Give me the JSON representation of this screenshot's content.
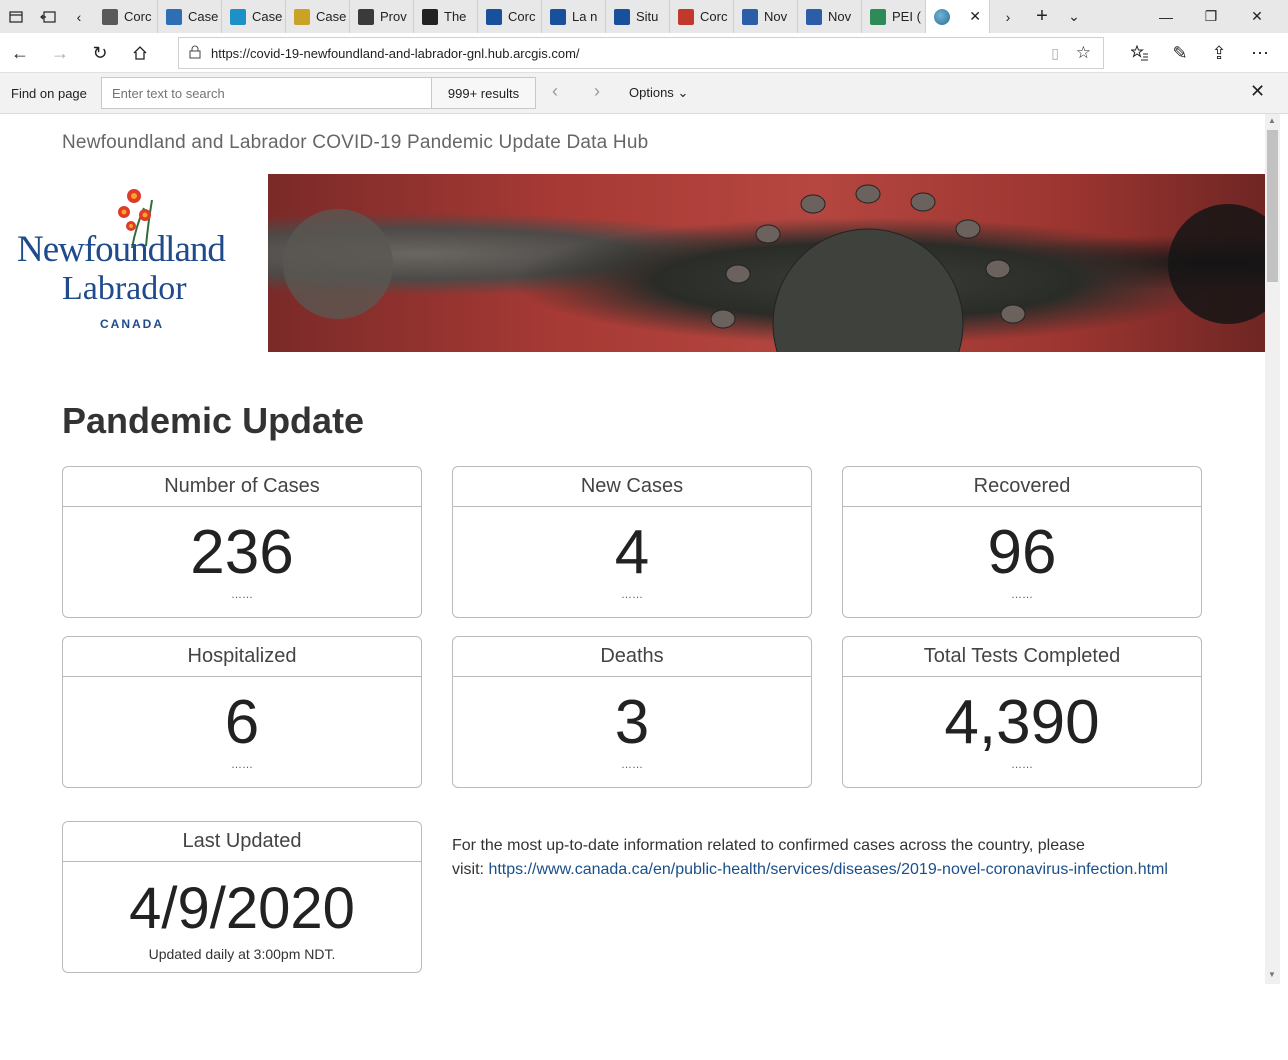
{
  "browser": {
    "tabs": [
      {
        "label": "Corc",
        "color": "#5a5a5a"
      },
      {
        "label": "Case",
        "color": "#2d6fb4"
      },
      {
        "label": "Case",
        "color": "#1e90c8"
      },
      {
        "label": "Case",
        "color": "#c9a227"
      },
      {
        "label": "Prov",
        "color": "#3a3a3a"
      },
      {
        "label": "The",
        "color": "#222222"
      },
      {
        "label": "Corc",
        "color": "#1a4f9c"
      },
      {
        "label": "La n",
        "color": "#1a4f9c"
      },
      {
        "label": "Situ",
        "color": "#1a4f9c"
      },
      {
        "label": "Corc",
        "color": "#c0392b"
      },
      {
        "label": "Nov",
        "color": "#2a5ea8"
      },
      {
        "label": "Nov",
        "color": "#2a5ea8"
      },
      {
        "label": "PEI (",
        "color": "#2e8b57"
      }
    ],
    "active_tab_color": "#3a7ca5",
    "url": "https://covid-19-newfoundland-and-labrador-gnl.hub.arcgis.com/",
    "find": {
      "label": "Find on page",
      "placeholder": "Enter text to search",
      "results": "999+ results",
      "options": "Options"
    }
  },
  "page": {
    "hub_title": "Newfoundland and Labrador COVID-19 Pandemic Update Data Hub",
    "logo": {
      "line1": "Newfoundland",
      "line2": "Labrador",
      "line3": "CANADA"
    },
    "section_title": "Pandemic Update",
    "cards": [
      {
        "label": "Number of Cases",
        "value": "236",
        "foot": "……"
      },
      {
        "label": "New Cases",
        "value": "4",
        "foot": "……"
      },
      {
        "label": "Recovered",
        "value": "96",
        "foot": "……"
      },
      {
        "label": "Hospitalized",
        "value": "6",
        "foot": "……"
      },
      {
        "label": "Deaths",
        "value": "3",
        "foot": "……"
      },
      {
        "label": "Total Tests Completed",
        "value": "4,390",
        "foot": "……"
      }
    ],
    "last_updated": {
      "label": "Last Updated",
      "value": "4/9/2020",
      "note": "Updated daily at 3:00pm NDT."
    },
    "info": {
      "text_line1": "For the most up-to-date information related to confirmed cases across the country, please",
      "text_prefix": "visit: ",
      "link": "https://www.canada.ca/en/public-health/services/diseases/2019-novel-coronavirus-infection.html"
    }
  }
}
